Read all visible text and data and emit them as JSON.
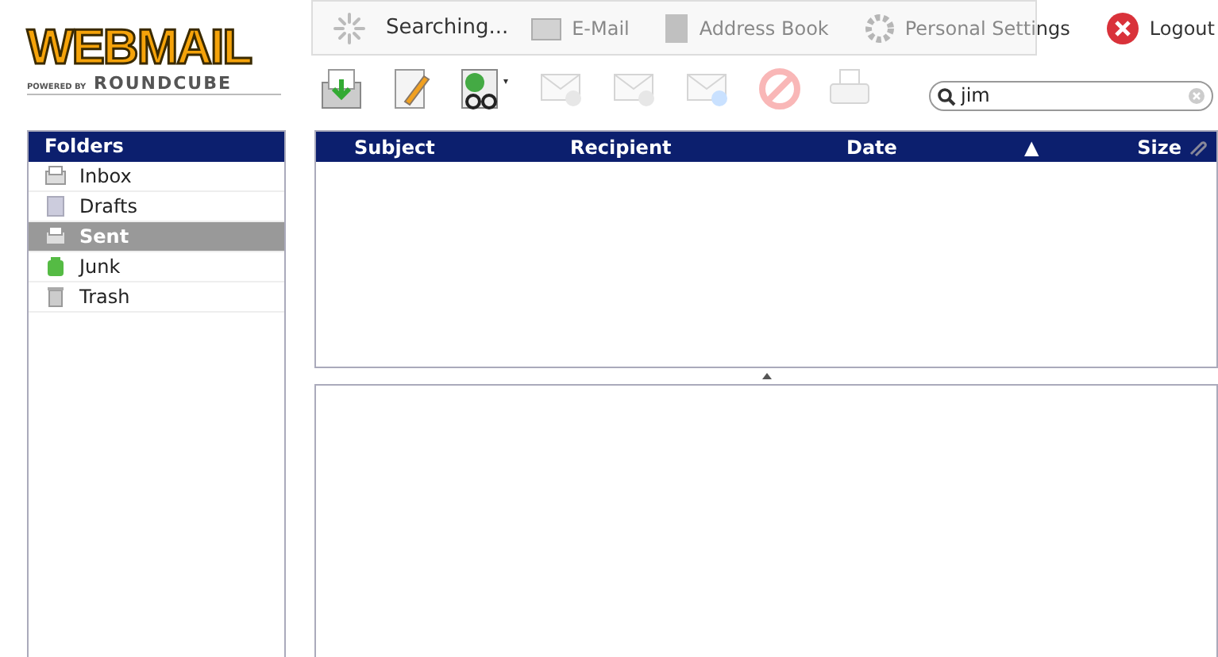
{
  "logo": {
    "title": "WEBMAIL",
    "powered_by": "POWERED BY",
    "brand": "ROUNDCUBE"
  },
  "status_overlay": {
    "text": "Searching..."
  },
  "nav": [
    {
      "label": "E-Mail",
      "kind": "mail"
    },
    {
      "label": "Address Book",
      "kind": "book"
    },
    {
      "label": "Personal Settings",
      "kind": "gear"
    },
    {
      "label": "Logout",
      "kind": "logout"
    }
  ],
  "toolbar": [
    {
      "kind": "check",
      "disabled": false
    },
    {
      "kind": "compose",
      "disabled": false
    },
    {
      "kind": "mark",
      "disabled": false
    },
    {
      "kind": "reply",
      "disabled": true
    },
    {
      "kind": "reply-all",
      "disabled": true
    },
    {
      "kind": "forward",
      "disabled": true
    },
    {
      "kind": "delete",
      "disabled": true
    },
    {
      "kind": "print",
      "disabled": true
    }
  ],
  "search": {
    "value": "jim"
  },
  "folders": {
    "title": "Folders",
    "items": [
      {
        "label": "Inbox",
        "kind": "inbox",
        "selected": false
      },
      {
        "label": "Drafts",
        "kind": "drafts",
        "selected": false
      },
      {
        "label": "Sent",
        "kind": "sent",
        "selected": true
      },
      {
        "label": "Junk",
        "kind": "junk",
        "selected": false
      },
      {
        "label": "Trash",
        "kind": "trash",
        "selected": false
      }
    ]
  },
  "table": {
    "columns": [
      "Subject",
      "Recipient",
      "Date",
      "▲",
      "Size"
    ]
  }
}
